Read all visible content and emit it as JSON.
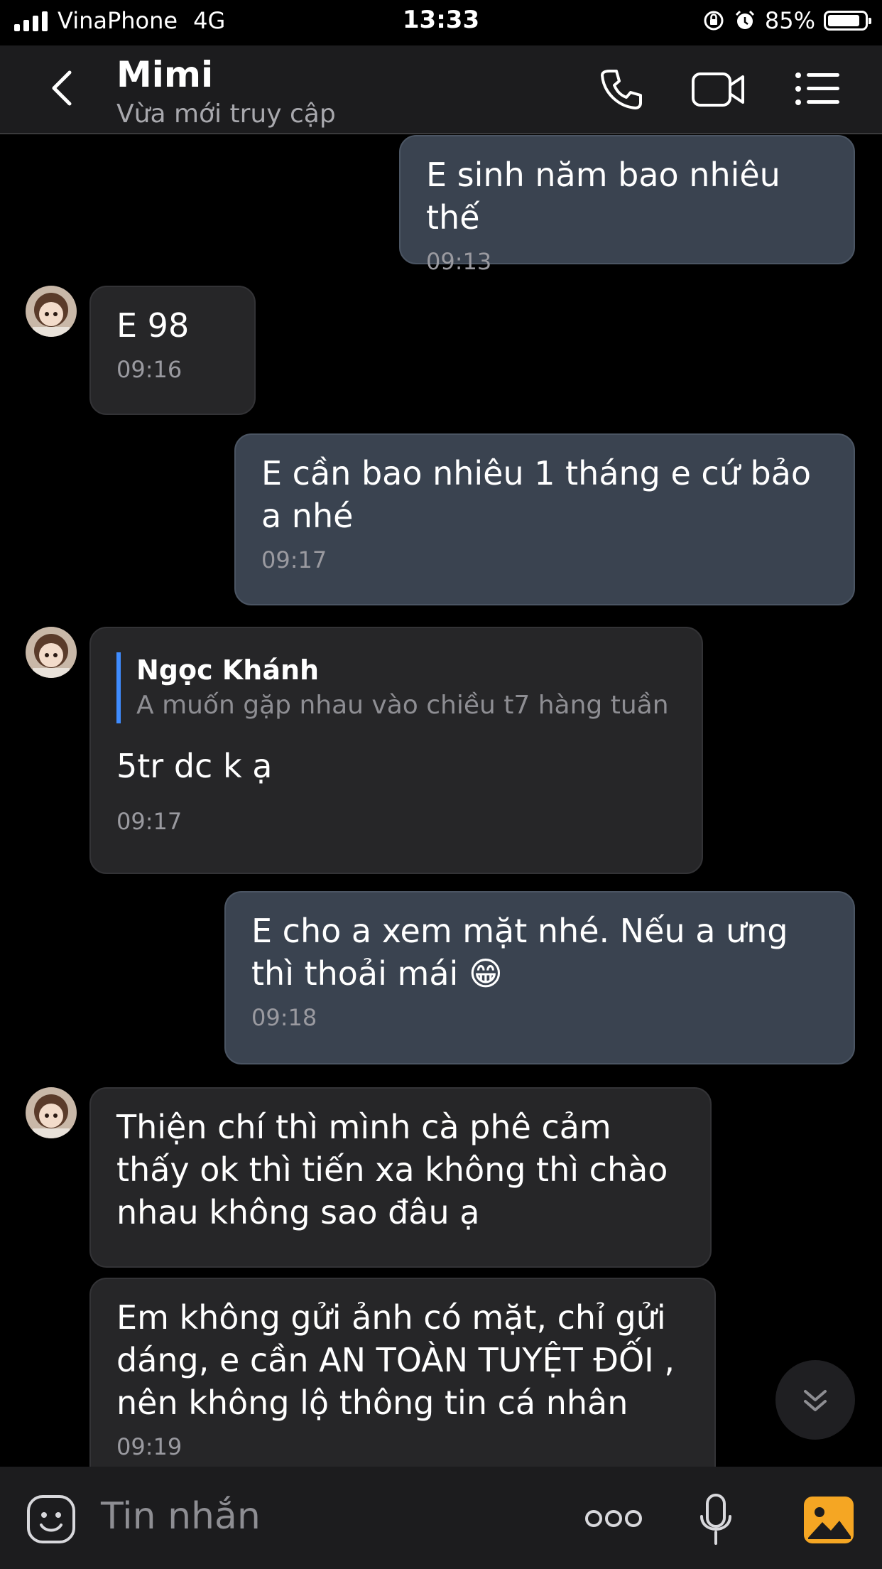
{
  "status_bar": {
    "carrier": "VinaPhone",
    "network": "4G",
    "time": "13:33",
    "battery": "85%",
    "battery_level": 0.85
  },
  "header": {
    "name": "Mimi",
    "status": "Vừa mới truy cập",
    "icons": [
      "back-icon",
      "phone-icon",
      "video-call-icon",
      "menu-list-icon"
    ]
  },
  "messages": [
    {
      "direction": "out",
      "text": "E sinh năm bao nhiêu thế",
      "time": "09:13"
    },
    {
      "direction": "in",
      "text": "E 98",
      "time": "09:16"
    },
    {
      "direction": "out",
      "text": "E cần bao nhiêu 1 tháng e cứ bảo a nhé",
      "time": "09:17"
    },
    {
      "direction": "in",
      "quote_name": "Ngọc Khánh",
      "quote_text": "A muốn gặp nhau vào chiều t7 hàng tuần",
      "text": "5tr dc k ạ",
      "time": "09:17"
    },
    {
      "direction": "out",
      "text": "E cho a xem mặt nhé. Nếu a ưng thì thoải mái 😁",
      "time": "09:18"
    },
    {
      "direction": "in",
      "text": "Thiện chí thì mình cà phê cảm thấy ok thì tiến xa không thì chào nhau không sao đâu ạ"
    },
    {
      "direction": "in",
      "text": "Em không gửi ảnh có mặt, chỉ gửi dáng, e cần AN TOÀN TUYỆT ĐỐI , nên không lộ thông tin cá nhân",
      "time": "09:19"
    }
  ],
  "composer": {
    "placeholder": "Tin nhắn",
    "icons": [
      "sticker-icon",
      "more-icon",
      "microphone-icon",
      "image-icon"
    ]
  },
  "colors": {
    "background": "#000000",
    "outgoing_bubble": "#3a4350",
    "incoming_bubble": "#262628",
    "quote_bar": "#3f8cff",
    "image_icon": "#f5a623"
  }
}
